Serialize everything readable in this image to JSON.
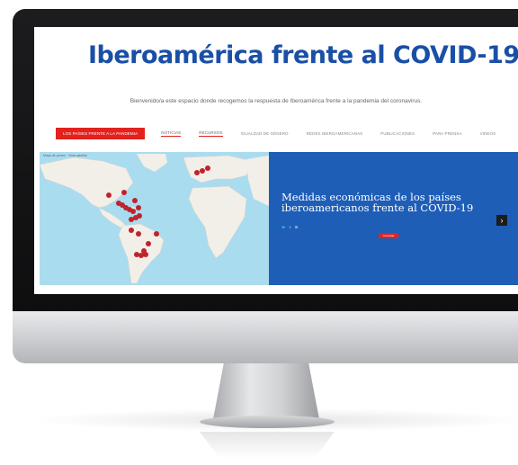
{
  "site": {
    "title": "Iberoamérica frente al COVID-19",
    "title_slash": "/",
    "welcome": "Bienvenido/a este espacio donde recogemos la respuesta de Iberoamérica frente a la pandemia del coronavirus.",
    "brand_color": "#1a4fa6",
    "accent_color": "#e3211d"
  },
  "nav": {
    "items": [
      {
        "label": "LOS PAÍSES FRENTE A LA PANDEMIA",
        "active": true
      },
      {
        "label": "NOTICIAS",
        "underlined": true
      },
      {
        "label": "RECURSOS",
        "underlined": true
      },
      {
        "label": "IGUALDAD DE GÉNERO"
      },
      {
        "label": "REDES IBEROAMERICANAS"
      },
      {
        "label": "PUBLICACIONES"
      },
      {
        "label": "PARA PRENSA"
      },
      {
        "label": "VIDEOS"
      }
    ]
  },
  "map": {
    "marker_color": "#c0232b",
    "markers_count_note": "",
    "toolbar": "Mapa de países · Vista satelital"
  },
  "info": {
    "title": "Medidas económicas de los países iberoamericanos frente al COVID-19",
    "button_label": "Consultar",
    "next_icon": "chevron-right-icon",
    "social_icons": [
      "twitter-icon",
      "facebook-icon",
      "email-icon"
    ]
  }
}
